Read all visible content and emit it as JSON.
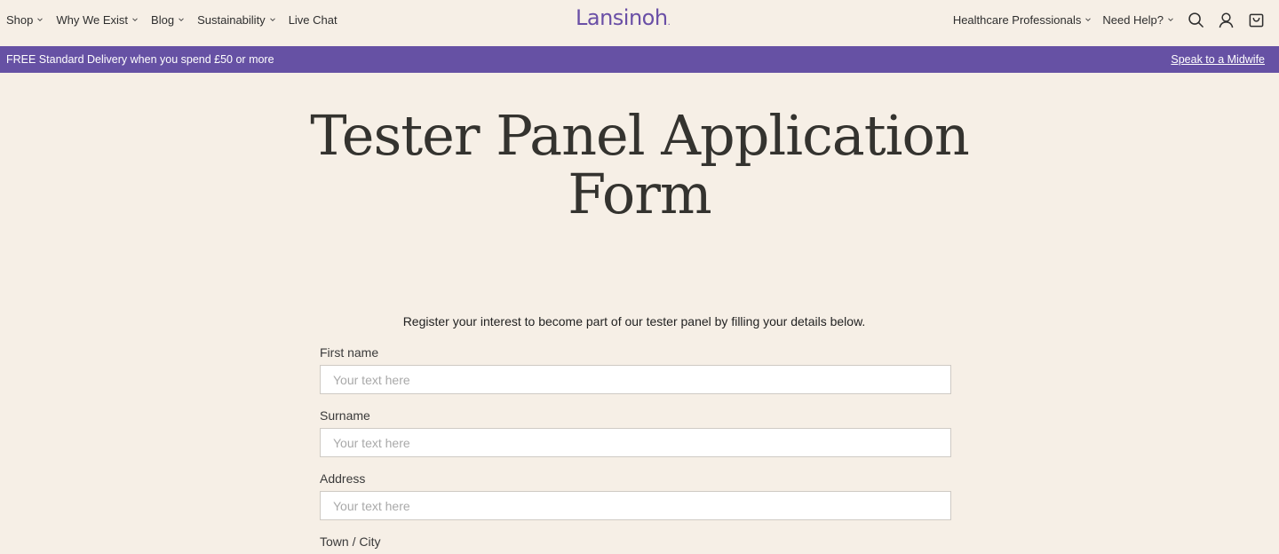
{
  "header": {
    "left_nav": [
      {
        "label": "Shop",
        "dropdown": true
      },
      {
        "label": "Why We Exist",
        "dropdown": true
      },
      {
        "label": "Blog",
        "dropdown": true
      },
      {
        "label": "Sustainability",
        "dropdown": true
      },
      {
        "label": "Live Chat",
        "dropdown": false
      }
    ],
    "logo": "Lansinoh",
    "logo_dot": ".",
    "right_nav": [
      {
        "label": "Healthcare Professionals",
        "dropdown": true
      },
      {
        "label": "Need Help?",
        "dropdown": true
      }
    ],
    "icons": [
      "search-icon",
      "account-icon",
      "cart-icon"
    ]
  },
  "promo": {
    "text": "FREE Standard Delivery when you spend £50 or more",
    "link": "Speak to a Midwife"
  },
  "page": {
    "title_line1": "Tester Panel Application",
    "title_line2": "Form",
    "intro": "Register your interest to become part of our tester panel by filling your details below."
  },
  "form": {
    "fields": [
      {
        "label": "First name",
        "placeholder": "Your text here",
        "value": ""
      },
      {
        "label": "Surname",
        "placeholder": "Your text here",
        "value": ""
      },
      {
        "label": "Address",
        "placeholder": "Your text here",
        "value": ""
      },
      {
        "label": "Town / City",
        "placeholder": "",
        "value": ""
      }
    ]
  },
  "colors": {
    "background": "#f6efe6",
    "brand_purple": "#6651a4",
    "logo_purple": "#6a4fa6",
    "title_text": "#34332f"
  }
}
